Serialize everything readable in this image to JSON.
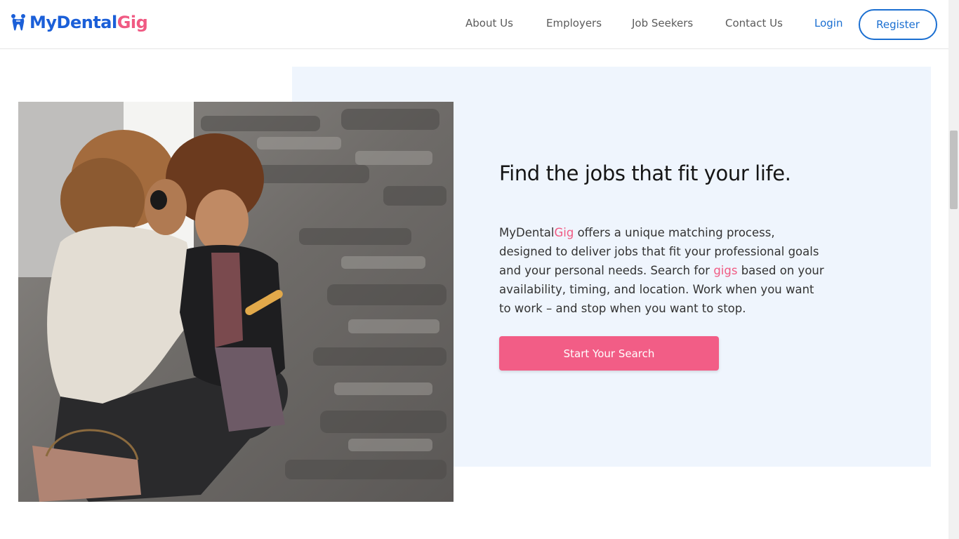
{
  "header": {
    "logo": {
      "part1": "MyDental",
      "part2": "Gig"
    },
    "nav": {
      "about": "About Us",
      "employers": "Employers",
      "job_seekers": "Job Seekers",
      "contact": "Contact Us",
      "login": "Login",
      "register": "Register"
    }
  },
  "hero": {
    "heading": "Find the jobs that fit your life.",
    "body": {
      "brand1": "MyDental",
      "brand2": "Gig",
      "seg1": " offers a unique matching process, designed to deliver jobs that fit your professional goals and your personal needs. Search for ",
      "gigs": "gigs",
      "seg2": " based on your availability, timing, and location. Work when you want to work – and stop when you want to stop."
    },
    "cta": "Start Your Search"
  },
  "colors": {
    "brand_blue": "#1b5fd8",
    "brand_pink": "#f05a83",
    "panel_bg": "#eff5fd",
    "cta_bg": "#f25d86"
  },
  "icons": {
    "logo": "tooth-icon"
  }
}
